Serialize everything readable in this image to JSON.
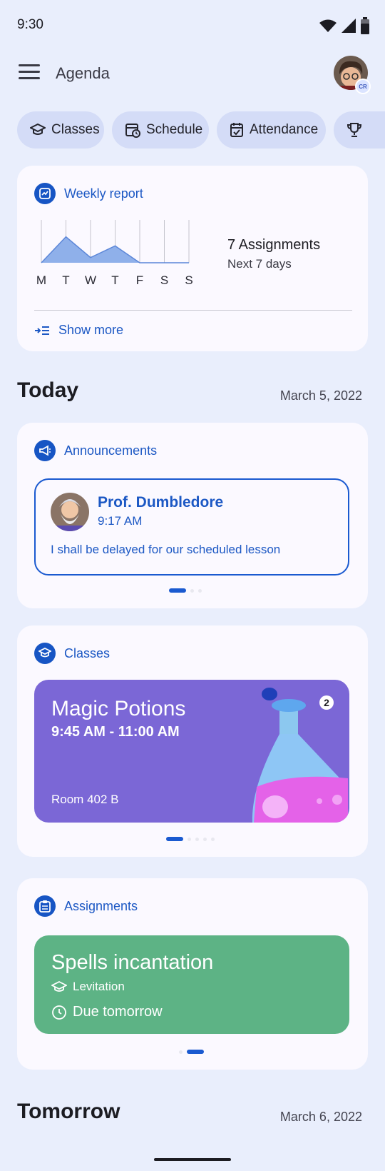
{
  "status_bar": {
    "time": "9:30"
  },
  "app_bar": {
    "title": "Agenda",
    "avatar_badge": "CR"
  },
  "chips": [
    {
      "label": "Classes",
      "icon": "graduation-cap-icon"
    },
    {
      "label": "Schedule",
      "icon": "schedule-icon"
    },
    {
      "label": "Attendance",
      "icon": "calendar-check-icon"
    },
    {
      "label": "",
      "icon": "trophy-icon"
    }
  ],
  "weekly_report": {
    "title": "Weekly report",
    "chart_data": {
      "type": "area",
      "categories": [
        "M",
        "T",
        "W",
        "T",
        "F",
        "S",
        "S"
      ],
      "values": [
        0,
        2,
        0.4,
        1.3,
        0,
        0,
        0
      ],
      "ylim": [
        0,
        3.3
      ]
    },
    "summary": "7 Assignments",
    "summary_sub": "Next 7 days",
    "show_more": "Show more"
  },
  "today": {
    "title": "Today",
    "date": "March 5, 2022"
  },
  "announcements": {
    "title": "Announcements",
    "item": {
      "author": "Prof. Dumbledore",
      "time": "9:17 AM",
      "message": "I shall be delayed for our scheduled lesson"
    }
  },
  "classes": {
    "title": "Classes",
    "item": {
      "name": "Magic Potions",
      "time": "9:45 AM - 11:00 AM",
      "room": "Room 402 B",
      "badge": "2",
      "color": "#7b67d6"
    }
  },
  "assignments": {
    "title": "Assignments",
    "item": {
      "name": "Spells incantation",
      "class": "Levitation",
      "due": "Due tomorrow",
      "color": "#5db385"
    }
  },
  "tomorrow": {
    "title": "Tomorrow",
    "date": "March 6, 2022"
  },
  "colors": {
    "accent": "#1a5ad0",
    "background": "#e9eefc",
    "chip": "#d4dcf7"
  }
}
